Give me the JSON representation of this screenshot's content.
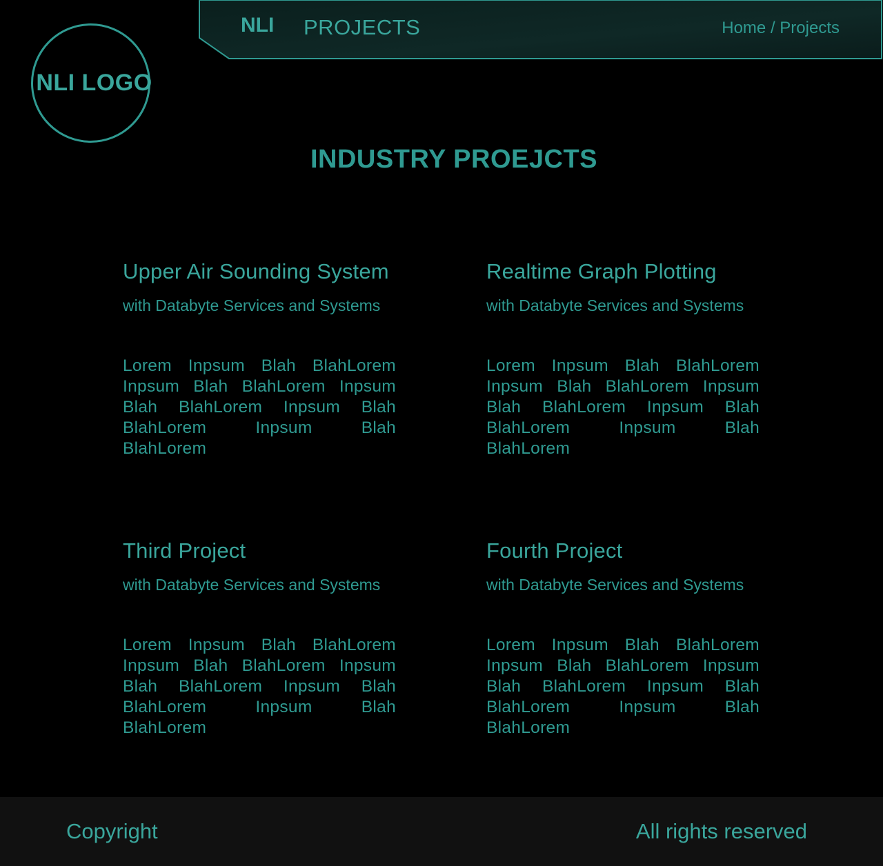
{
  "logo": {
    "text": "NLI LOGO"
  },
  "nav": {
    "brand": "NLI",
    "section": "PROJECTS",
    "breadcrumb": {
      "home": "Home",
      "separator": " / ",
      "current": "Projects"
    }
  },
  "page": {
    "title": "INDUSTRY PROEJCTS"
  },
  "projects": [
    {
      "title": "Upper Air Sounding System",
      "subtitle": "with Databyte Services and Systems",
      "body": "Lorem Inpsum Blah BlahLorem Inpsum Blah BlahLorem Inpsum Blah BlahLorem Inpsum Blah BlahLorem Inpsum Blah BlahLorem"
    },
    {
      "title": "Realtime Graph Plotting",
      "subtitle": "with Databyte Services and Systems",
      "body": "Lorem Inpsum Blah BlahLorem Inpsum Blah BlahLorem Inpsum Blah BlahLorem Inpsum Blah BlahLorem Inpsum Blah BlahLorem"
    },
    {
      "title": "Third Project",
      "subtitle": "with Databyte Services and Systems",
      "body": "Lorem Inpsum Blah BlahLorem Inpsum Blah BlahLorem Inpsum Blah BlahLorem Inpsum Blah BlahLorem Inpsum Blah BlahLorem"
    },
    {
      "title": "Fourth Project",
      "subtitle": "with Databyte Services and Systems",
      "body": "Lorem Inpsum Blah BlahLorem Inpsum Blah BlahLorem Inpsum Blah BlahLorem Inpsum Blah BlahLorem Inpsum Blah BlahLorem"
    }
  ],
  "footer": {
    "left": "Copyright",
    "right": "All rights reserved"
  },
  "colors": {
    "accent": "#2f9a91",
    "background": "#000000",
    "footer_bg": "#111111",
    "header_bg": "#0c2220"
  }
}
